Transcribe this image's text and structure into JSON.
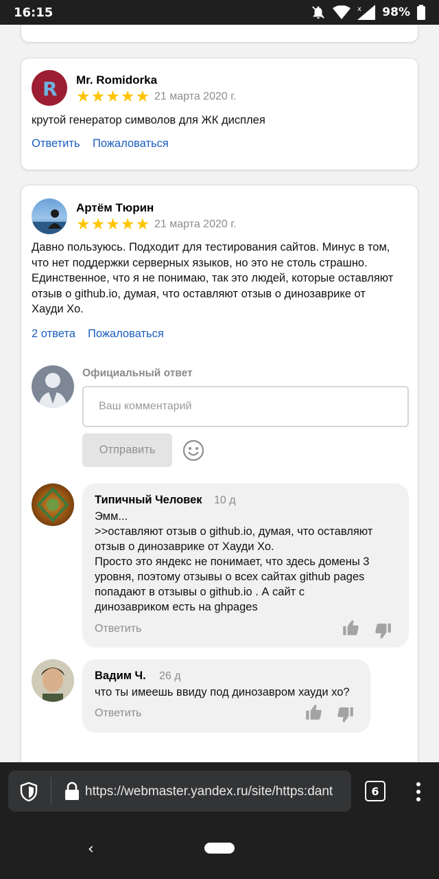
{
  "status_bar": {
    "time": "16:15",
    "battery": "98%",
    "icons": [
      "notifications-off-icon",
      "wifi-icon",
      "signal-icon",
      "battery-icon"
    ]
  },
  "reviews": [
    {
      "author": "Mr. Romidorka",
      "rating": 5,
      "stars": [
        "★",
        "★",
        "★",
        "★",
        "★"
      ],
      "date": "21 марта 2020 г.",
      "text": "крутой генератор символов для ЖК дисплея",
      "reply_label": "Ответить",
      "report_label": "Пожаловаться"
    },
    {
      "author": "Артём Тюрин",
      "rating": 5,
      "stars": [
        "★",
        "★",
        "★",
        "★",
        "★"
      ],
      "date": "21 марта 2020 г.",
      "text_lines": [
        "Давно пользуюсь. Подходит для тестирования сайтов. Минус в том,",
        "что нет поддержки серверных языков, но это не столь страшно.",
        "Единственное, что я не понимаю, так это людей, которые оставляют",
        "отзыв о github.io, думая, что оставляют отзыв о динозаврике от",
        "Хауди Хо."
      ],
      "replies_label": "2 ответа",
      "report_label": "Пожаловаться",
      "official_reply": {
        "label": "Официальный ответ",
        "placeholder": "Ваш комментарий",
        "send_label": "Отправить"
      },
      "replies": [
        {
          "author": "Типичный Человек",
          "age": "10 д",
          "text_lines": [
            "Эмм...",
            ">>оставляют отзыв о github.io, думая, что оставляют",
            "отзыв о динозаврике от Хауди Хо.",
            "Просто это яндекс не понимает, что здесь домены 3",
            "уровня, поэтому отзывы о всех сайтах github pages",
            "попадают в отзывы о github.io .  А сайт с",
            "динозавриком есть на ghpages"
          ],
          "reply_label": "Ответить"
        },
        {
          "author": "Вадим Ч.",
          "age": "26 д",
          "text_lines": [
            "что ты имеешь ввиду под динозавром хауди хо?"
          ],
          "reply_label": "Ответить"
        }
      ]
    }
  ],
  "browser": {
    "url": "https://webmaster.yandex.ru/site/https:dant",
    "tab_count": "6"
  },
  "nav": {
    "back_glyph": "‹"
  }
}
